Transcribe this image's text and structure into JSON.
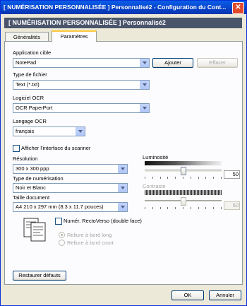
{
  "window": {
    "title": "[  NUMÉRISATION PERSONNALISÉE  ]  Personnalisé2 - Configuration du Cont..."
  },
  "banner": {
    "title": "[  NUMÉRISATION PERSONNALISÉE  ]    Personnalisé2"
  },
  "tabs": [
    {
      "label": "Généralités"
    },
    {
      "label": "Paramètres"
    }
  ],
  "application": {
    "label": "Application cible",
    "value": "NotePad",
    "add_label": "Ajouter",
    "delete_label": "Effacer"
  },
  "file_type": {
    "label": "Type de fichier",
    "value": "Text (*.txt)"
  },
  "ocr_software": {
    "label": "Logiciel OCR",
    "value": "OCR PaperPort"
  },
  "ocr_language": {
    "label": "Langage OCR",
    "value": "français"
  },
  "show_scanner_ui": {
    "label": "Afficher l'interface du scanner",
    "checked": false
  },
  "resolution": {
    "label": "Résolution",
    "value": "300 x 300 ppp"
  },
  "scan_type": {
    "label": "Type de numérisation",
    "value": "Noir et Blanc"
  },
  "document_size": {
    "label": "Taille document",
    "value": "A4 210 x 297 mm (8.3 x 11.7 pouces)"
  },
  "duplex": {
    "label": "Numér. RectoVerso (double face)",
    "checked": false,
    "long_edge_label": "Reliure à bord long",
    "short_edge_label": "Reliure à bord court"
  },
  "brightness": {
    "label": "Luminosité",
    "value": "50",
    "level": 0.5
  },
  "contrast": {
    "label": "Contraste",
    "value": "50",
    "level": 0.5
  },
  "restore_label": "Restaurer défauts",
  "ok_label": "OK",
  "cancel_label": "Annuler",
  "colors": {
    "titlebar": "#0A5FE8",
    "banner": "#4A556B",
    "dialog_bg": "#ECE9D8",
    "panel_bg": "#FCFCFE"
  }
}
